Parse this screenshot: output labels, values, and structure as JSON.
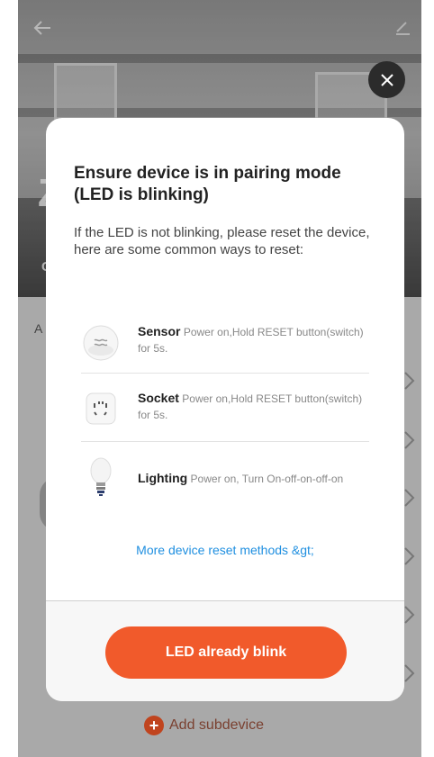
{
  "background": {
    "hero_large_letter": "Z",
    "hero_small_letter": "C",
    "list_side_letter": "A",
    "add_subdevice_label": "Add subdevice"
  },
  "modal": {
    "title": "Ensure device is in pairing mode (LED is blinking)",
    "description": "If the LED is not blinking, please reset the device, here are some common ways to reset:",
    "devices": [
      {
        "name": "Sensor",
        "instruction": "Power on,Hold RESET button(switch) for 5s.",
        "icon": "sensor-icon"
      },
      {
        "name": "Socket",
        "instruction": "Power on,Hold RESET button(switch) for 5s.",
        "icon": "socket-icon"
      },
      {
        "name": "Lighting",
        "instruction": "Power on, Turn On-off-on-off-on",
        "icon": "bulb-icon"
      }
    ],
    "more_link": "More device reset methods &gt;",
    "primary_button": "LED already blink"
  },
  "colors": {
    "accent": "#f15a2b",
    "link": "#1f8fe0"
  }
}
